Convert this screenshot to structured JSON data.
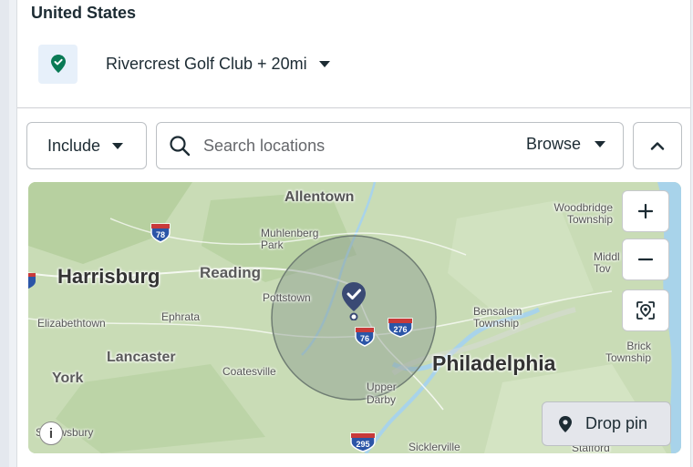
{
  "region": {
    "title": "United States"
  },
  "location": {
    "label": "Rivercrest Golf Club + 20mi",
    "icon": "map-pin-check-icon",
    "icon_color": "#0a7a55"
  },
  "controls": {
    "include_label": "Include",
    "search_placeholder": "Search locations",
    "browse_label": "Browse"
  },
  "map": {
    "cities": {
      "allentown": "Allentown",
      "woodbridge": "Woodbridge Township",
      "muhlenberg": "Muhlenberg Park",
      "harrisburg": "Harrisburg",
      "reading": "Reading",
      "pottstown": "Pottstown",
      "middletown": "Middl Tov",
      "elizabethtown": "Elizabethtown",
      "ephrata": "Ephrata",
      "bensalem": "Bensalem Township",
      "lancaster": "Lancaster",
      "brick": "Brick Township",
      "york": "York",
      "coatesville": "Coatesville",
      "philadelphia": "Philadelphia",
      "upper_darby": "Upper Darby",
      "shrewsbury": "Shrewsbury",
      "sicklerville": "Sicklerville",
      "stafford": "Stafford"
    },
    "shields": {
      "i78": "78",
      "i76": "76",
      "i276": "276",
      "i295": "295"
    },
    "drop_pin_label": "Drop pin",
    "info_label": "i",
    "zoom_in": "+",
    "zoom_out": "−",
    "colors": {
      "land": "#c9dcb6",
      "water": "#a8d3ea",
      "radius": "#8a9a8f",
      "pin": "#3a4a74"
    }
  }
}
